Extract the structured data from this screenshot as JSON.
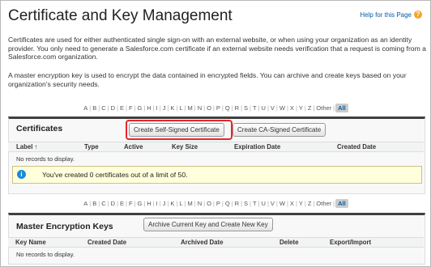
{
  "page": {
    "title": "Certificate and Key Management",
    "help_text": "Help for this Page",
    "intro1": "Certificates are used for either authenticated single sign-on with an external website, or when using your organization as an identity provider. You only need to generate a Salesforce.com certificate if an external website needs verification that a request is coming from a Salesforce.com organization.",
    "intro2": "A master encryption key is used to encrypt the data contained in encrypted fields. You can archive and create keys based on your organization's security needs."
  },
  "alphabet": [
    "A",
    "B",
    "C",
    "D",
    "E",
    "F",
    "G",
    "H",
    "I",
    "J",
    "K",
    "L",
    "M",
    "N",
    "O",
    "P",
    "Q",
    "R",
    "S",
    "T",
    "U",
    "V",
    "W",
    "X",
    "Y",
    "Z",
    "Other",
    "All"
  ],
  "certificates": {
    "title": "Certificates",
    "create_self_signed": "Create Self-Signed Certificate",
    "create_ca_signed": "Create CA-Signed Certificate",
    "columns": [
      "Label ↑",
      "Type",
      "Active",
      "Key Size",
      "Expiration Date",
      "Created Date"
    ],
    "empty_text": "No records to display.",
    "info_text": "You've created 0 certificates out of a limit of 50."
  },
  "keys": {
    "title": "Master Encryption Keys",
    "archive_button": "Archive Current Key and Create New Key",
    "columns": [
      "Key Name",
      "Created Date",
      "Archived Date",
      "Delete",
      "Export/Import"
    ],
    "empty_text": "No records to display."
  },
  "colors": {
    "highlight": "#e8262c",
    "link": "#015ba7",
    "section_border": "#3f3f3f",
    "info_bg": "#ffffdc"
  }
}
